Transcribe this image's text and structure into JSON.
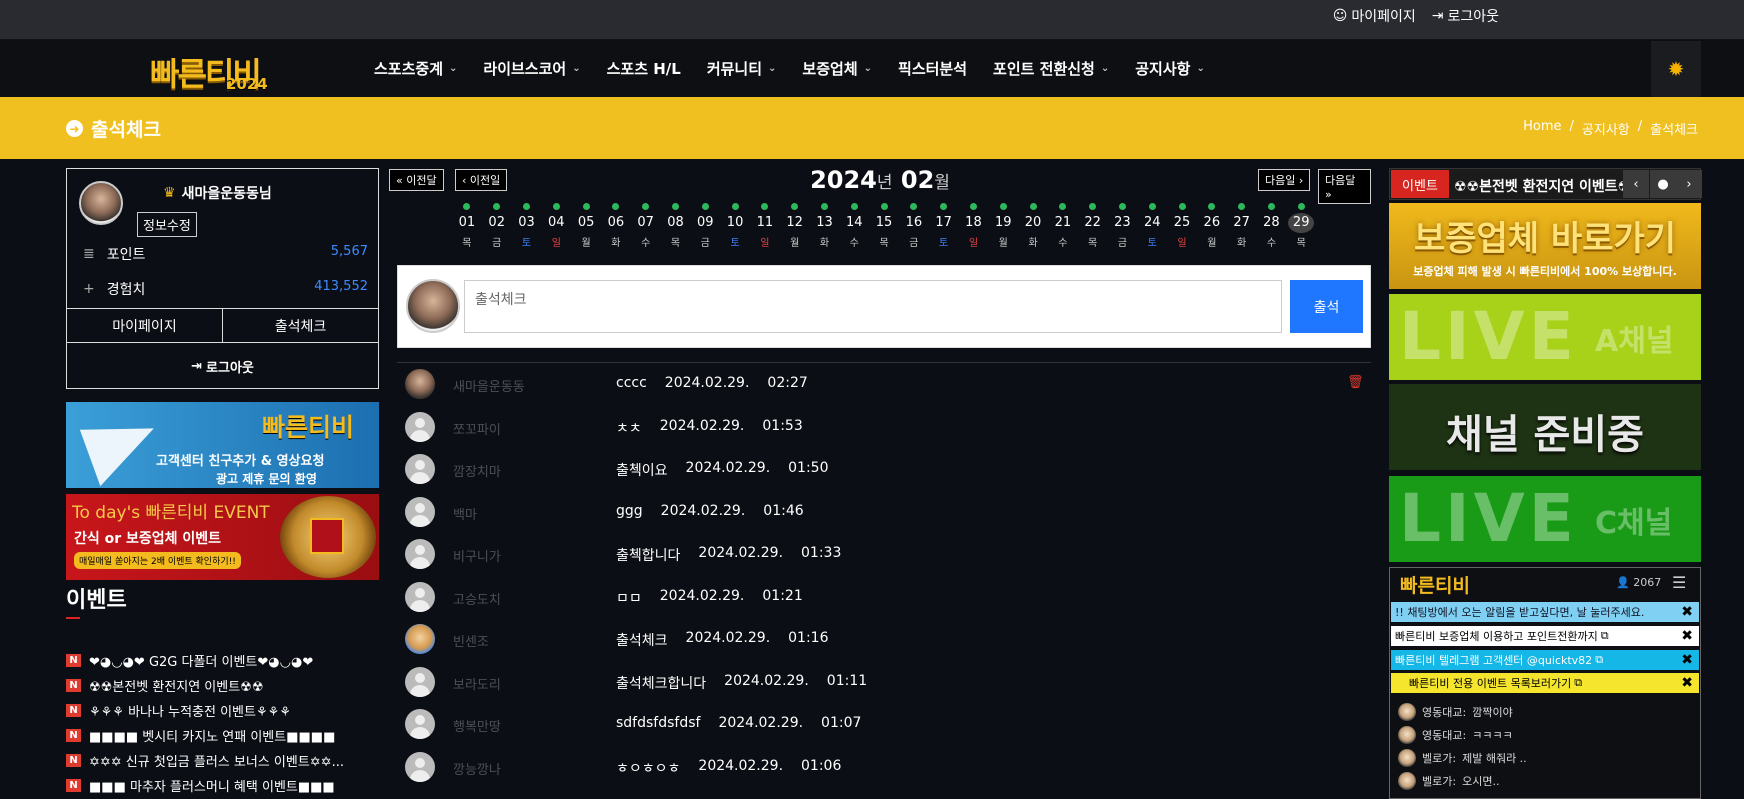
{
  "topbar": {
    "mypage": "마이페이지",
    "logout": "로그아웃"
  },
  "logo": {
    "main": "빠른티비",
    "year": "2024"
  },
  "nav": [
    {
      "label": "스포츠중계",
      "dropdown": true
    },
    {
      "label": "라이브스코어",
      "dropdown": true
    },
    {
      "label": "스포츠 H/L",
      "dropdown": false
    },
    {
      "label": "커뮤니티",
      "dropdown": true
    },
    {
      "label": "보증업체",
      "dropdown": true
    },
    {
      "label": "픽스터분석",
      "dropdown": false
    },
    {
      "label": "포인트 전환신청",
      "dropdown": true
    },
    {
      "label": "공지사항",
      "dropdown": true
    }
  ],
  "page": {
    "title": "출석체크",
    "breadcrumb": [
      "Home",
      "/",
      "공지사항",
      "/",
      "출석체크"
    ]
  },
  "profile": {
    "nickname": "새마을운동동님",
    "edit": "정보수정",
    "point_label": "포인트",
    "point_value": "5,567",
    "exp_label": "경험치",
    "exp_value": "413,552",
    "mypage_btn": "마이페이지",
    "attend_btn": "출석체크",
    "logout_btn": "로그아웃"
  },
  "banner_telegram": {
    "title": "빠른티비",
    "line1": "고객센터 친구추가 & 영상요청",
    "line2": "광고 제휴 문의 환영"
  },
  "banner_event": {
    "line1": "To day's 빠른티비 EVENT",
    "line2": "간식 or 보증업체 이벤트",
    "line3": "매일매일 쏟아지는 2배 이벤트 확인하기!!"
  },
  "events": {
    "title": "이벤트",
    "items": [
      "❤◕◡◕❤ G2G 다폴더 이벤트❤◕◡◕❤",
      "☢☢본전벳 환전지연 이벤트☢☢",
      "⚘⚘⚘ 바나나 누적충전 이벤트⚘⚘⚘",
      "■■■■ 벳시티 카지노 연패 이벤트■■■■",
      "✡✡✡ 신규 첫입금 플러스 보너스 이벤트✡✡...",
      "■■■ 마추자 플러스머니 혜택 이벤트■■■"
    ]
  },
  "calendar": {
    "prev_month": "이전달",
    "prev_day": "이전일",
    "next_day": "다음일",
    "next_month": "다음달",
    "year": "2024",
    "year_unit": "년",
    "month": "02",
    "month_unit": "월",
    "days": [
      {
        "d": "01",
        "w": "목"
      },
      {
        "d": "02",
        "w": "금"
      },
      {
        "d": "03",
        "w": "토"
      },
      {
        "d": "04",
        "w": "일"
      },
      {
        "d": "05",
        "w": "월"
      },
      {
        "d": "06",
        "w": "화"
      },
      {
        "d": "07",
        "w": "수"
      },
      {
        "d": "08",
        "w": "목"
      },
      {
        "d": "09",
        "w": "금"
      },
      {
        "d": "10",
        "w": "토"
      },
      {
        "d": "11",
        "w": "일"
      },
      {
        "d": "12",
        "w": "월"
      },
      {
        "d": "13",
        "w": "화"
      },
      {
        "d": "14",
        "w": "수"
      },
      {
        "d": "15",
        "w": "목"
      },
      {
        "d": "16",
        "w": "금"
      },
      {
        "d": "17",
        "w": "토"
      },
      {
        "d": "18",
        "w": "일"
      },
      {
        "d": "19",
        "w": "월"
      },
      {
        "d": "20",
        "w": "화"
      },
      {
        "d": "21",
        "w": "수"
      },
      {
        "d": "22",
        "w": "목"
      },
      {
        "d": "23",
        "w": "금"
      },
      {
        "d": "24",
        "w": "토"
      },
      {
        "d": "25",
        "w": "일"
      },
      {
        "d": "26",
        "w": "월"
      },
      {
        "d": "27",
        "w": "화"
      },
      {
        "d": "28",
        "w": "수"
      },
      {
        "d": "29",
        "w": "목"
      }
    ],
    "today": "29"
  },
  "write": {
    "placeholder": "출석체크",
    "submit": "출석"
  },
  "attendance": [
    {
      "name": "새마을운동동",
      "msg": "cccc",
      "date": "2024.02.29.",
      "time": "02:27",
      "avatar": "photo",
      "own": true
    },
    {
      "name": "쪼꼬파이",
      "msg": "ㅊㅊ",
      "date": "2024.02.29.",
      "time": "01:53",
      "avatar": "def",
      "own": false
    },
    {
      "name": "깜장치마",
      "msg": "출첵이요",
      "date": "2024.02.29.",
      "time": "01:50",
      "avatar": "def",
      "own": false
    },
    {
      "name": "백마",
      "msg": "ggg",
      "date": "2024.02.29.",
      "time": "01:46",
      "avatar": "def",
      "own": false
    },
    {
      "name": "비구니가",
      "msg": "출첵합니다",
      "date": "2024.02.29.",
      "time": "01:33",
      "avatar": "def",
      "own": false
    },
    {
      "name": "고승도치",
      "msg": "ㅁㅁ",
      "date": "2024.02.29.",
      "time": "01:21",
      "avatar": "def",
      "own": false
    },
    {
      "name": "빈센조",
      "msg": "출석체크",
      "date": "2024.02.29.",
      "time": "01:16",
      "avatar": "cart",
      "own": false
    },
    {
      "name": "보라도리",
      "msg": "출석체크합니다",
      "date": "2024.02.29.",
      "time": "01:11",
      "avatar": "def",
      "own": false
    },
    {
      "name": "행복만땅",
      "msg": "sdfdsfdsfdsf",
      "date": "2024.02.29.",
      "time": "01:07",
      "avatar": "def",
      "own": false
    },
    {
      "name": "깡능깡나",
      "msg": "ㅎㅇㅎㅇㅎ",
      "date": "2024.02.29.",
      "time": "01:06",
      "avatar": "def",
      "own": false
    }
  ],
  "right": {
    "event_tag": "이벤트",
    "event_text": "☢☢본전벳 환전지연 이벤트☢",
    "ban1_title": "보증업체 바로가기",
    "ban1_sub": "보증업체 피해 발생 시 빠른티비에서 100% 보상합니다.",
    "live_a_big": "LIVE",
    "live_a_sm": "A채널",
    "ready": "채널 준비중",
    "live_c_big": "LIVE",
    "live_c_sm": "C채널"
  },
  "chat": {
    "logo": "빠른티비",
    "count": "2067",
    "notices": [
      "!! 채팅방에서 오는 알림을 받고싶다면, 날 눌러주세요.",
      "빠른티비 보증업체 이용하고 포인트전환까지",
      "빠른티비 텔레그램 고객센터 @quicktv82",
      "빠른티비 전용 이벤트 목록보러가기"
    ],
    "messages": [
      {
        "user": "영동대교",
        "text": "깜짝이야"
      },
      {
        "user": "영동대교",
        "text": "ㅋㅋㅋㅋ"
      },
      {
        "user": "벨로가",
        "text": "제발 해줘라 .."
      },
      {
        "user": "벨로가",
        "text": "오시면.."
      }
    ]
  },
  "colors": {
    "accent": "#f0c020",
    "primary_btn": "#1f77ff",
    "value_blue": "#3d8bff",
    "new_badge": "#e03b2f"
  }
}
